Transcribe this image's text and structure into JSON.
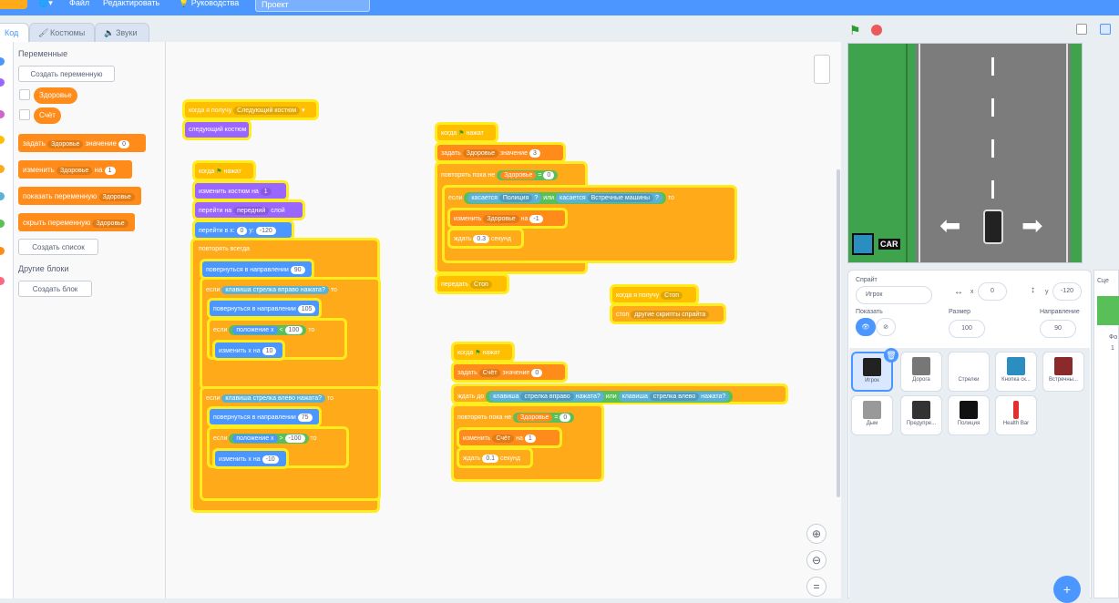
{
  "menu": {
    "file": "Файл",
    "edit": "Редактировать",
    "tutorials": "Руководства",
    "project_title": "Проект"
  },
  "tabs": {
    "code": "Код",
    "costumes": "Костюмы",
    "sounds": "Звуки"
  },
  "palette": {
    "heading": "Переменные",
    "make_var": "Создать переменную",
    "var1": "Здоровье",
    "var2": "Счёт",
    "b_set": "задать",
    "b_set_var": "Здоровье",
    "b_set_to": "значение",
    "b_set_val": "0",
    "b_change": "изменить",
    "b_change_var": "Здоровье",
    "b_change_by": "на",
    "b_change_val": "1",
    "b_show": "показать переменную",
    "b_show_var": "Здоровье",
    "b_hide": "скрыть переменную",
    "b_hide_var": "Здоровье",
    "make_list": "Создать список",
    "more_heading": "Другие блоки",
    "make_block": "Создать блок"
  },
  "s1": {
    "hat": "когда я получу",
    "msg": "Следующий костюм",
    "next": "следующий костюм"
  },
  "s2": {
    "hat": "когда",
    "clicked": "нажат",
    "costume": "изменить костюм на",
    "c_val": "1",
    "front": "перейти на",
    "layer": "передний",
    "layer_w": "слой",
    "goto": "перейти в x:",
    "gx": "0",
    "gy": "-120",
    "y": "y:",
    "forever": "повторять всегда",
    "point": "повернуться в направлении",
    "p1": "90",
    "if": "если",
    "key": "клавиша",
    "k_right": "стрелка вправо",
    "pressed": "нажата?",
    "then": "то",
    "p2": "105",
    "xpos": "положение x",
    "lt": "<",
    "v100": "100",
    "chx": "изменить x на",
    "dx1": "10",
    "k_left": "стрелка влево",
    "p3": "75",
    "gt": ">",
    "vm100": "-100",
    "dx2": "-10"
  },
  "s3": {
    "hat": "когда",
    "clicked": "нажат",
    "set": "задать",
    "var": "Здоровье",
    "to": "значение",
    "val": "3",
    "repeat_until": "повторять пока не",
    "eq": "=",
    "zero": "0",
    "if": "если",
    "touching": "касается",
    "police": "Полиция",
    "q": "?",
    "or": "или",
    "oncoming": "Встречные машины",
    "then": "то",
    "change": "изменить",
    "by": "на",
    "m1": "-1",
    "wait": "ждать",
    "w": "0.3",
    "sec": "секунд",
    "broadcast": "передать",
    "stop": "Стоп"
  },
  "s4": {
    "hat": "когда я получу",
    "msg": "Стоп",
    "stop": "стоп",
    "other": "другие скрипты спрайта"
  },
  "s5": {
    "hat": "когда",
    "clicked": "нажат",
    "set": "задать",
    "var": "Счёт",
    "to": "значение",
    "val": "0",
    "wait_until": "ждать до",
    "key": "клавиша",
    "k_right": "стрелка вправо",
    "pressed": "нажата?",
    "or": "или",
    "k_left": "стрелка влево",
    "repeat_until": "повторять пока не",
    "hp": "Здоровье",
    "eq": "=",
    "zero": "0",
    "change": "изменить",
    "by": "на",
    "one": "1",
    "wait": "ждать",
    "w": "0.1",
    "sec": "секунд"
  },
  "stage": {
    "logo": "CAR"
  },
  "sprite": {
    "label": "Спрайт",
    "name": "Игрок",
    "x": "0",
    "y": "-120",
    "x_l": "x",
    "y_l": "y",
    "show": "Показать",
    "size_l": "Размер",
    "size": "100",
    "dir_l": "Направление",
    "dir": "90"
  },
  "sprites": [
    "Игрок",
    "Дорога",
    "Стрелки",
    "Кнопка ск...",
    "Встречны...",
    "Дым",
    "Предупре...",
    "Полиция",
    "Health Bar"
  ],
  "scene": {
    "label": "Сце",
    "bg": "Фо",
    "n": "1"
  }
}
